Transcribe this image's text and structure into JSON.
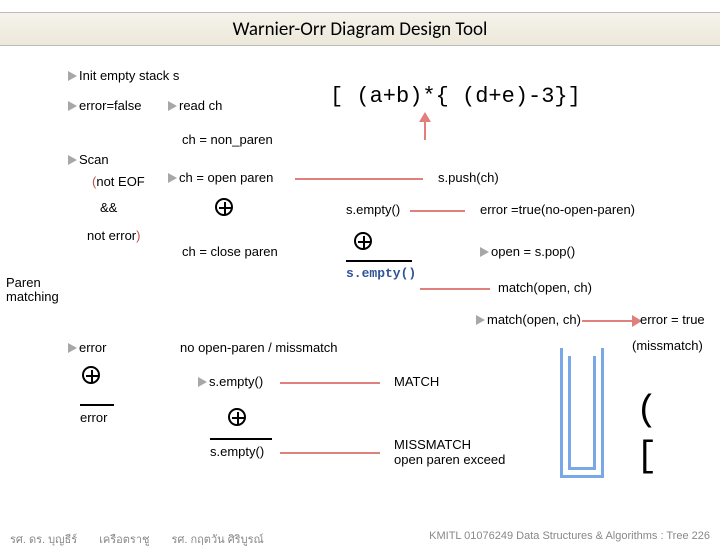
{
  "title": "Warnier-Orr Diagram Design Tool",
  "formula": "[ (a+b)*{ (d+e)-3}]",
  "nodes": {
    "init": "Init empty stack s",
    "err_false": "error=false",
    "read_ch": "read ch",
    "scan": "Scan",
    "not_eof": "(not EOF",
    "and": "&&",
    "not_error": "not error)",
    "paren_matching": "Paren matching",
    "ch_non_paren": "ch = non_paren",
    "ch_open": "ch = open paren",
    "ch_close": "ch = close paren",
    "s_push": "s.push(ch)",
    "s_empty": "s.empty()",
    "err_true_noopen": "error =true(no-open-paren)",
    "open_pop": "open = s.pop()",
    "match_open_ch": "match(open, ch)",
    "match_open_ch2": "match(open, ch)",
    "err_true": "error = true",
    "missmatch": "(missmatch)",
    "error": "error",
    "no_open_miss": "no open-paren / missmatch",
    "match_caps": "MATCH",
    "mismatch_caps": "MISSMATCH",
    "open_exceed": "open paren exceed"
  },
  "glyphs": {
    "paren": "(",
    "bracket": "["
  },
  "footer": {
    "left1": "รศ. ดร. บุญธีร์",
    "left2": "เครือตราชู",
    "left3": "รศ. กฤตวัน  ศิริบูรณ์",
    "right": "KMITL   01076249 Data Structures & Algorithms : Tree 226"
  }
}
